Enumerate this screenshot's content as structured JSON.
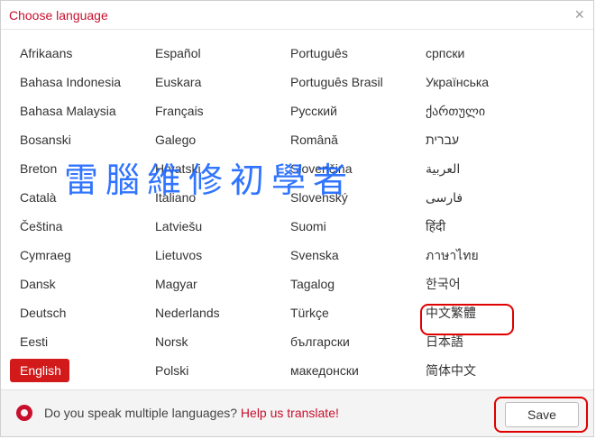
{
  "title": "Choose language",
  "close": "×",
  "languages": [
    [
      "Afrikaans",
      "Español",
      "Português",
      "српски"
    ],
    [
      "Bahasa Indonesia",
      "Euskara",
      "Português Brasil",
      "Українська"
    ],
    [
      "Bahasa Malaysia",
      "Français",
      "Русский",
      "ქართული"
    ],
    [
      "Bosanski",
      "Galego",
      "Română",
      "עברית"
    ],
    [
      "Breton",
      "Hrvatski",
      "Slovenčina",
      "العربية"
    ],
    [
      "Català",
      "Italiano",
      "Slovenský",
      "فارسی"
    ],
    [
      "Čeština",
      "Latviešu",
      "Suomi",
      "हिंदी"
    ],
    [
      "Cymraeg",
      "Lietuvos",
      "Svenska",
      "ภาษาไทย"
    ],
    [
      "Dansk",
      "Magyar",
      "Tagalog",
      "한국어"
    ],
    [
      "Deutsch",
      "Nederlands",
      "Türkçe",
      "中文繁體"
    ],
    [
      "Eesti",
      "Norsk",
      "български",
      "日本語"
    ],
    [
      "English",
      "Polski",
      "македонски",
      "简体中文"
    ]
  ],
  "selected": "English",
  "watermark": "雷腦維修初學者",
  "footer": {
    "question": "Do you speak multiple languages?",
    "link": "Help us translate!",
    "save": "Save"
  }
}
